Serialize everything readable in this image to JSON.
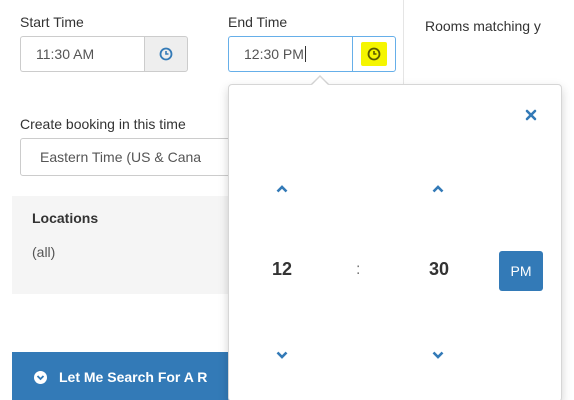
{
  "start_time": {
    "label": "Start Time",
    "value": "11:30 AM",
    "icon": "clock-icon"
  },
  "end_time": {
    "label": "End Time",
    "value": "12:30 PM",
    "icon": "clock-icon",
    "icon_highlight_color": "#f5f500"
  },
  "timezone": {
    "label": "Create booking in this time",
    "value": "Eastern Time (US & Cana"
  },
  "locations": {
    "title": "Locations",
    "value": "(all)"
  },
  "search_button": {
    "label": "Let Me Search For A R",
    "icon": "chevron-circle-down-icon"
  },
  "rooms": {
    "text": "Rooms matching y"
  },
  "time_picker": {
    "hour": "12",
    "separator": ":",
    "minute": "30",
    "meridian": "PM",
    "close_icon": "close-icon",
    "up_icon": "chevron-up-icon",
    "down_icon": "chevron-down-icon"
  },
  "colors": {
    "accent": "#337ab7",
    "highlight": "#f5f500",
    "panel_bg": "#f5f5f5"
  }
}
